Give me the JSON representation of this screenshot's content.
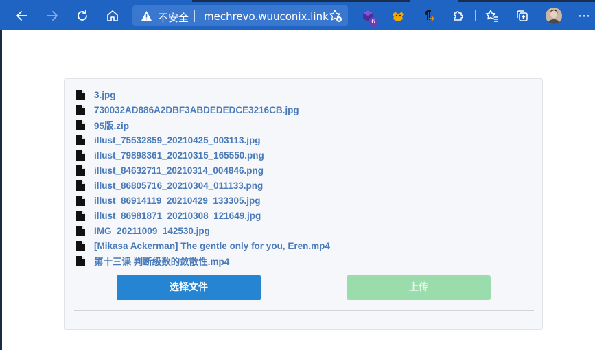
{
  "browser": {
    "address": {
      "security_label": "不安全",
      "url": "mechrevo.wuuconix.link"
    },
    "extension_badge": "6",
    "colors": {
      "toolbar": "#1f63c3",
      "address_bar": "#3a78d0"
    }
  },
  "page": {
    "files": [
      {
        "name": "3.jpg"
      },
      {
        "name": "730032AD886A2DBF3ABDEDEDCE3216CB.jpg"
      },
      {
        "name": "95版.zip"
      },
      {
        "name": "illust_75532859_20210425_003113.jpg"
      },
      {
        "name": "illust_79898361_20210315_165550.png"
      },
      {
        "name": "illust_84632711_20210314_004846.png"
      },
      {
        "name": "illust_86805716_20210304_011133.png"
      },
      {
        "name": "illust_86914119_20210429_133305.jpg"
      },
      {
        "name": "illust_86981871_20210308_121649.jpg"
      },
      {
        "name": "IMG_20211009_142530.jpg"
      },
      {
        "name": "[Mikasa Ackerman] The gentle only for you, Eren.mp4"
      },
      {
        "name": "第十三课 判断级数的敛散性.mp4"
      }
    ],
    "select_button_label": "选择文件",
    "upload_button_label": "上传",
    "colors": {
      "file_link": "#4a7ab8",
      "select_button": "#2585d3",
      "upload_button_disabled": "#9adcac"
    }
  }
}
